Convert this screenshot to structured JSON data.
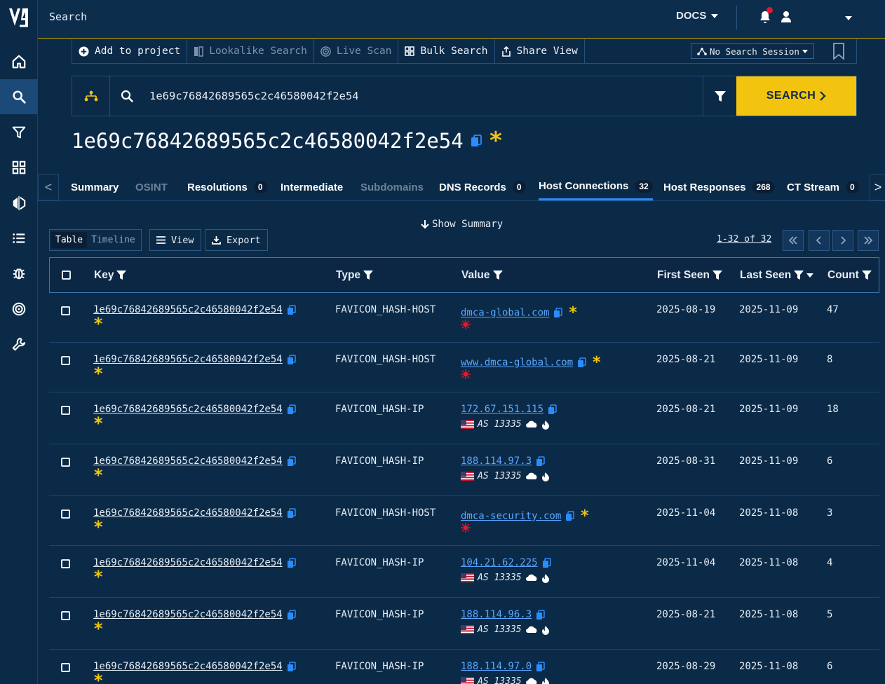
{
  "app": {
    "logo_text": "V",
    "page_title": "Search"
  },
  "header": {
    "docs_label": "DOCS"
  },
  "sidebar": {
    "items": [
      {
        "name": "home-icon"
      },
      {
        "name": "search-icon"
      },
      {
        "name": "filter-icon"
      },
      {
        "name": "dashboard-icon"
      },
      {
        "name": "compare-icon"
      },
      {
        "name": "list-icon"
      },
      {
        "name": "bug-icon"
      },
      {
        "name": "target-icon"
      },
      {
        "name": "wrench-icon"
      }
    ]
  },
  "toolbar": {
    "add_project": "Add to project",
    "lookalike": "Lookalike Search",
    "live_scan": "Live Scan",
    "bulk_search": "Bulk Search",
    "share_view": "Share View",
    "session": "No Search Session"
  },
  "search": {
    "query": "1e69c76842689565c2c46580042f2e54",
    "button": "SEARCH"
  },
  "heading": {
    "hash": "1e69c76842689565c2c46580042f2e54"
  },
  "tabs": [
    {
      "label": "Summary",
      "count": null,
      "state": "normal"
    },
    {
      "label": "OSINT",
      "count": null,
      "state": "disabled"
    },
    {
      "label": "Resolutions",
      "count": "0",
      "state": "normal"
    },
    {
      "label": "Intermediate",
      "count": null,
      "state": "normal"
    },
    {
      "label": "Subdomains",
      "count": null,
      "state": "disabled"
    },
    {
      "label": "DNS Records",
      "count": "0",
      "state": "normal"
    },
    {
      "label": "Host Connections",
      "count": "32",
      "state": "active"
    },
    {
      "label": "Host Responses",
      "count": "268",
      "state": "normal"
    },
    {
      "label": "CT Stream",
      "count": "0",
      "state": "normal"
    }
  ],
  "controls": {
    "show_summary": "Show Summary",
    "view_table": "Table",
    "view_timeline": "Timeline",
    "view_btn": "View",
    "export_btn": "Export",
    "pager_text": "1-32 of 32"
  },
  "table": {
    "columns": [
      "Key",
      "Type",
      "Value",
      "First Seen",
      "Last Seen",
      "Count"
    ],
    "rows": [
      {
        "key": "1e69c76842689565c2c46580042f2e54",
        "type": "FAVICON_HASH-HOST",
        "value": "dmca-global.com",
        "kind": "host",
        "first": "2025-08-19",
        "last": "2025-11-09",
        "count": "47"
      },
      {
        "key": "1e69c76842689565c2c46580042f2e54",
        "type": "FAVICON_HASH-HOST",
        "value": "www.dmca-global.com",
        "kind": "host",
        "first": "2025-08-21",
        "last": "2025-11-09",
        "count": "8"
      },
      {
        "key": "1e69c76842689565c2c46580042f2e54",
        "type": "FAVICON_HASH-IP",
        "value": "172.67.151.115",
        "kind": "ip",
        "asn": "AS 13335",
        "first": "2025-08-21",
        "last": "2025-11-09",
        "count": "18"
      },
      {
        "key": "1e69c76842689565c2c46580042f2e54",
        "type": "FAVICON_HASH-IP",
        "value": "188.114.97.3",
        "kind": "ip",
        "asn": "AS 13335",
        "first": "2025-08-31",
        "last": "2025-11-09",
        "count": "6"
      },
      {
        "key": "1e69c76842689565c2c46580042f2e54",
        "type": "FAVICON_HASH-HOST",
        "value": "dmca-security.com",
        "kind": "host",
        "first": "2025-11-04",
        "last": "2025-11-08",
        "count": "3"
      },
      {
        "key": "1e69c76842689565c2c46580042f2e54",
        "type": "FAVICON_HASH-IP",
        "value": "104.21.62.225",
        "kind": "ip",
        "asn": "AS 13335",
        "first": "2025-11-04",
        "last": "2025-11-08",
        "count": "4"
      },
      {
        "key": "1e69c76842689565c2c46580042f2e54",
        "type": "FAVICON_HASH-IP",
        "value": "188.114.96.3",
        "kind": "ip",
        "asn": "AS 13335",
        "first": "2025-08-21",
        "last": "2025-11-08",
        "count": "5"
      },
      {
        "key": "1e69c76842689565c2c46580042f2e54",
        "type": "FAVICON_HASH-IP",
        "value": "188.114.97.0",
        "kind": "ip",
        "asn": "AS 13335",
        "first": "2025-08-29",
        "last": "2025-11-08",
        "count": "6"
      }
    ]
  },
  "colors": {
    "accent": "#f2c40f",
    "link": "#5aa7ff",
    "active_tab": "#2a8cff",
    "alert": "#e0192e"
  }
}
